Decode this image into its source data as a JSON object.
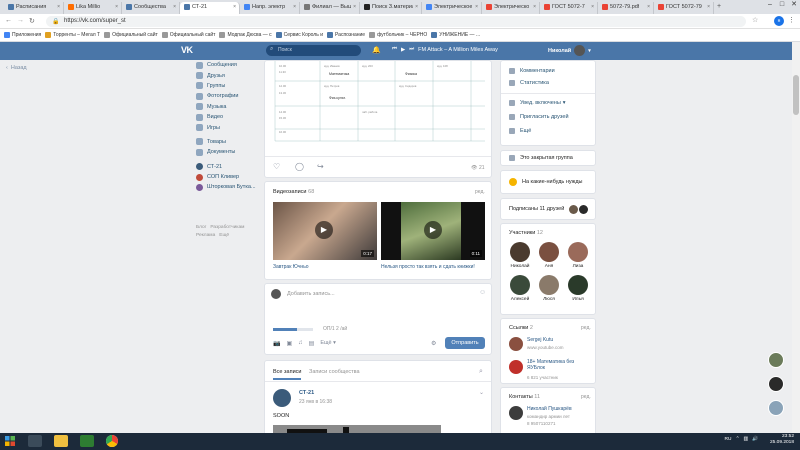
{
  "browser": {
    "tabs": [
      {
        "label": "Расписания",
        "color": "#4a76a8"
      },
      {
        "label": "Lika Millio",
        "color": "#ff6d00"
      },
      {
        "label": "Сообщества",
        "color": "#4a76a8"
      },
      {
        "label": "СТ-21",
        "color": "#4a76a8",
        "active": true
      },
      {
        "label": "Напр. электр",
        "color": "#4285f4"
      },
      {
        "label": "Филиал — Выше",
        "color": "#777777"
      },
      {
        "label": "Поиск З.материал",
        "color": "#222222"
      },
      {
        "label": "Электрическое",
        "color": "#4285f4"
      },
      {
        "label": "Электрическо",
        "color": "#ea4335"
      },
      {
        "label": "ГОСТ 5072-7",
        "color": "#ea4335"
      },
      {
        "label": "5072-79.pdf",
        "color": "#ea4335"
      },
      {
        "label": "ГОСТ 5072-79",
        "color": "#ea4335"
      }
    ],
    "url": "https://vk.com/super_st",
    "bookmarks": [
      {
        "label": "Приложения",
        "color": "#4285f4"
      },
      {
        "label": "Торренты – Мегал Т",
        "color": "#e0a020"
      },
      {
        "label": "Официальный сайт",
        "color": "#999999"
      },
      {
        "label": "Официальный сайт",
        "color": "#999999"
      },
      {
        "label": "Модпак Дюсва — с",
        "color": "#999999"
      },
      {
        "label": "Сервис Король и",
        "color": "#4a76a8"
      },
      {
        "label": "Распознание",
        "color": "#4a76a8"
      },
      {
        "label": "футбольчик – ЧЕРНО",
        "color": "#999999"
      },
      {
        "label": "УНИЖЕНИЕ — ...",
        "color": "#4a76a8"
      }
    ]
  },
  "vk": {
    "logo": "VK",
    "search_placeholder": "Поиск",
    "track": "FM Attack – A Million Miles Away",
    "user_name": "Николай",
    "prev_link": "Назад",
    "menu": [
      "Сообщения",
      "Друзья",
      "Группы",
      "Фотографии",
      "Музыка",
      "Видео",
      "Игры"
    ],
    "menu2": [
      "Товары",
      "Документы"
    ],
    "menu3": [
      "СТ-21",
      "СОП Кливер",
      "Шторковая Бутка..."
    ],
    "footer": [
      "Блог",
      "Разработчикам",
      "Реклама",
      "Ещё"
    ],
    "schedule": {
      "rows": [
        [
          "",
          "",
          "Математика",
          "",
          "",
          "Физика",
          ""
        ],
        [
          "",
          "",
          "",
          "",
          "",
          "",
          ""
        ],
        [
          "",
          "",
          "Физ.культ.",
          "",
          "",
          "",
          ""
        ],
        [
          "",
          "",
          "",
          "",
          "",
          "",
          ""
        ]
      ],
      "likes": "21"
    },
    "videos": {
      "title": "Видеозаписи",
      "count": "68",
      "edit": "ред.",
      "items": [
        {
          "caption": "Завтрак Ючньо",
          "duration": "0:17"
        },
        {
          "caption": "Нельзя просто так взять и сдать книжки!",
          "duration": "0:11"
        }
      ]
    },
    "composer": {
      "placeholder": "Добавить запись...",
      "upload_text": "ОП/1 2 /ай",
      "more_label": "Ещё",
      "send_label": "Отправить"
    },
    "wall": {
      "tab_all": "Все записи",
      "tab_community": "Записи сообщества",
      "post_author": "СТ-21",
      "post_date": "23 янв в 16:38",
      "post_text": "SOON"
    },
    "right": {
      "actions": [
        "Комментарии",
        "Статистика"
      ],
      "notify": "Увед. включены",
      "invite": "Пригласить друзей",
      "more": "Ещё",
      "closed_group": "Это закрытая группа",
      "status_needed": "На какие-нибудь нужды",
      "friends_subscribed": "Подписаны 11 друзей",
      "members_title": "Участники",
      "members_count": "12",
      "members": [
        "Николай",
        "Аня",
        "Лиза",
        "Алексей",
        "Люся",
        "Илья"
      ],
      "links_title": "Ссылки",
      "links_count": "2",
      "links_edit": "ред.",
      "links": [
        {
          "title": "Sergej Kutu",
          "sub": "www.youtube.com"
        },
        {
          "title": "18+ Математика без ЯУБлок",
          "sub": "6 821 участник"
        }
      ],
      "contacts_title": "Контакты",
      "contacts_count": "11",
      "contacts_edit": "ред.",
      "contact_name": "Николай Пушкарёв",
      "contact_role": "командир армии лет",
      "contact_phone": "8 9507110271"
    }
  },
  "taskbar": {
    "lang": "RU",
    "time": "23:52",
    "date": "25.09.2018"
  }
}
